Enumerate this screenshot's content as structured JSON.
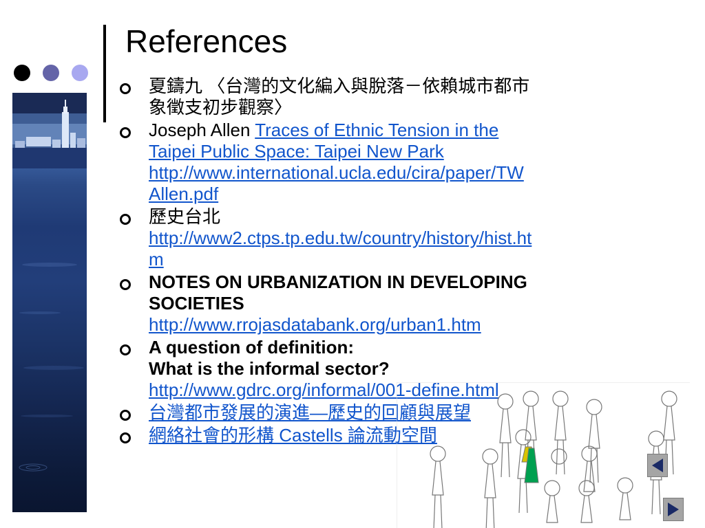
{
  "slide": {
    "title": "References",
    "references": [
      {
        "parts": [
          {
            "line": "夏鑄九 〈台灣的文化編入與脫落－依賴城市都市"
          },
          {
            "line": "象徵支初步觀察〉"
          }
        ]
      },
      {
        "prefix": "Joseph Allen ",
        "link_text_1": "Traces of Ethnic Tension in the",
        "link_text_2": "Taipei Public Space: Taipei New Park",
        "url_1": "http://www.international.ucla.edu/cira/paper/TW",
        "url_2": "Allen.pdf"
      },
      {
        "label": "歷史台北",
        "url_1": "http://www2.ctps.tp.edu.tw/country/history/hist.ht",
        "url_2": "m"
      },
      {
        "bold_1": "NOTES ON URBANIZATION IN DEVELOPING",
        "bold_2": "SOCIETIES",
        "url": "http://www.rrojasdatabank.org/urban1.htm"
      },
      {
        "bold_1": "A question of definition:",
        "bold_2": "What is the informal sector?",
        "url": "http://www.gdrc.org/informal/001-define.html"
      },
      {
        "link": "台灣都市發展的演進—歷史的回顧與展望"
      },
      {
        "link": "網絡社會的形構 Castells 論流動空間"
      }
    ]
  },
  "nav": {
    "prev_icon": "triangle-left-icon",
    "next_icon": "triangle-right-icon"
  },
  "colors": {
    "link": "#1155cc",
    "dot_1": "#000000",
    "dot_2": "#6464a8",
    "dot_3": "#a8a8f0",
    "nav_button": "#a5a5a5"
  }
}
